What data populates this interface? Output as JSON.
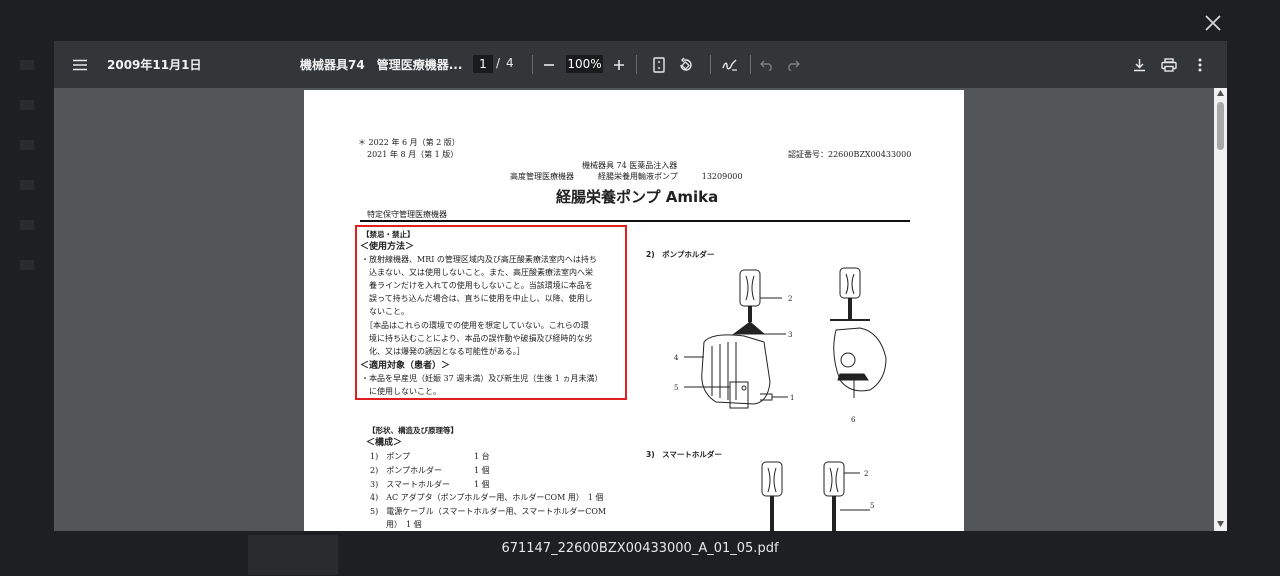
{
  "viewer": {
    "date_title": "2009年11月1日",
    "doc_title": "機械器具74　管理医療機器...",
    "page_current": "1",
    "page_sep": "/",
    "page_total": "4",
    "zoom": "100%"
  },
  "icons": {
    "menu": "menu-icon",
    "close": "close-icon",
    "zoom_out": "minus-icon",
    "zoom_in": "plus-icon",
    "fit_page": "fit-page-icon",
    "rotate": "rotate-icon",
    "annotate": "annotate-icon",
    "undo": "undo-icon",
    "redo": "redo-icon",
    "download": "download-icon",
    "print": "print-icon",
    "more": "more-vert-icon"
  },
  "doc": {
    "rev1": "＊ 2022 年 6 月（第 2 版）",
    "rev2": "2021 年 8 月（第 1 版）",
    "cert_no": "認証番号：22600BZX00433000",
    "cat1": "機械器具 74  医薬品注入器",
    "cat2": "高度管理医療機器　　　経腸栄養用輸液ポンプ　　　13209000",
    "main_title": "経腸栄養ポンプ Amika",
    "special": "特定保守管理医療機器",
    "warn_head": "【禁忌・禁止】",
    "usage_head": "＜使用方法＞",
    "warn_lines": [
      "・放射線機器、MRI の管理区域内及び高圧酸素療法室内へは持ち",
      "　込まない、又は使用しないこと。また、高圧酸素療法室内へ栄",
      "　養ラインだけを入れての使用もしないこと。当該環境に本品を",
      "　誤って持ち込んだ場合は、直ちに使用を中止し、以降、使用し",
      "　ないこと。",
      "　［本品はこれらの環境での使用を想定していない。これらの環",
      "　境に持ち込むことにより、本品の誤作動や破損及び経時的な劣",
      "　化、又は爆発の誘因となる可能性がある。］"
    ],
    "target_head": "＜適用対象（患者）＞",
    "target_lines": [
      "・本品を早産児（妊娠 37 週未満）及び新生児（生後 1 ヵ月未満）",
      "　に使用しないこと。"
    ],
    "shape_head": "【形状、構造及び原理等】",
    "struct_head": "＜構成＞",
    "parts": [
      "1)　ポンプ　　　　　　　　1 台",
      "2)　ポンプホルダー　　　　1 個",
      "3)　スマートホルダー　　　1 個",
      "4)　AC アダプタ（ポンプホルダー用、ホルダーCOM 用）　1 個",
      "5)　電源ケーブル（スマートホルダー用、スマートホルダーCOM",
      "　　用）　1 個"
    ],
    "fig2_title": "2)　ポンプホルダー",
    "fig3_title": "3)　スマートホルダー",
    "fig_labels": [
      "2",
      "3",
      "4",
      "5",
      "1",
      "6",
      "2",
      "5"
    ]
  },
  "footer": {
    "filename": "671147_22600BZX00433000_A_01_05.pdf"
  },
  "colors": {
    "toolbar": "#323639",
    "content_bg": "#525659",
    "highlight_box": "#e0201e"
  }
}
